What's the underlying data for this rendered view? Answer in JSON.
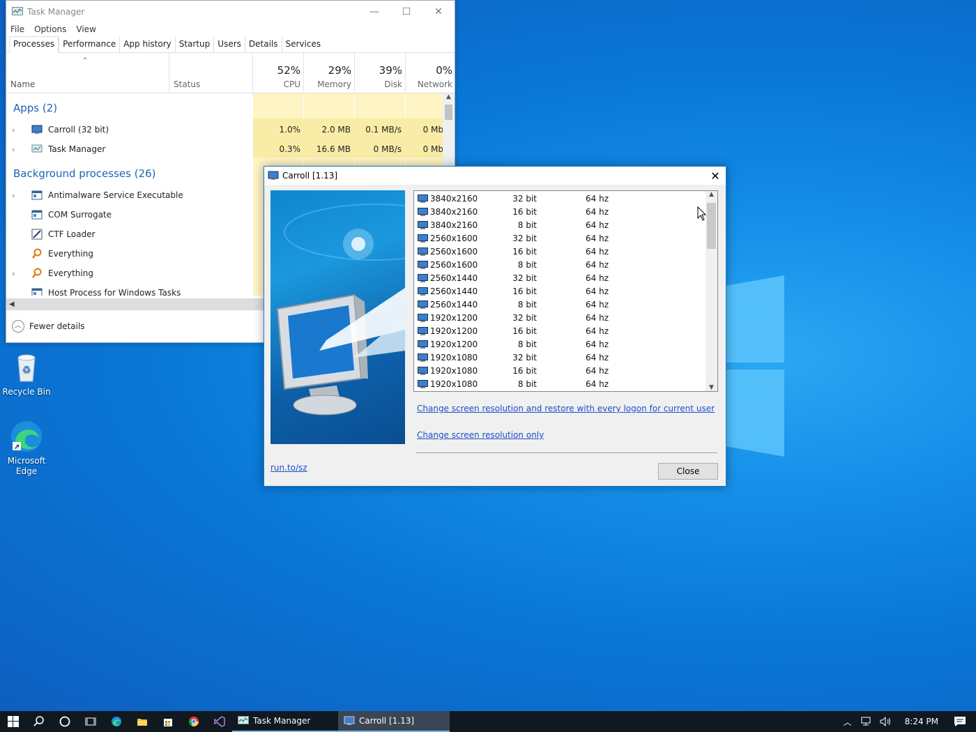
{
  "desktop": {
    "icons": [
      {
        "label": "Recycle Bin"
      },
      {
        "label": "Microsoft Edge"
      }
    ]
  },
  "task_manager": {
    "title": "Task Manager",
    "menu": [
      "File",
      "Options",
      "View"
    ],
    "tabs": [
      "Processes",
      "Performance",
      "App history",
      "Startup",
      "Users",
      "Details",
      "Services"
    ],
    "columns": {
      "name": "Name",
      "status": "Status",
      "cpu": {
        "pct": "52%",
        "label": "CPU"
      },
      "memory": {
        "pct": "29%",
        "label": "Memory"
      },
      "disk": {
        "pct": "39%",
        "label": "Disk"
      },
      "network": {
        "pct": "0%",
        "label": "Network"
      }
    },
    "apps_group": "Apps (2)",
    "apps": [
      {
        "name": "Carroll (32 bit)",
        "cpu": "1.0%",
        "memory": "2.0 MB",
        "disk": "0.1 MB/s",
        "network": "0 Mb"
      },
      {
        "name": "Task Manager",
        "cpu": "0.3%",
        "memory": "16.6 MB",
        "disk": "0 MB/s",
        "network": "0 Mb"
      }
    ],
    "bg_group": "Background processes (26)",
    "bg_processes": [
      {
        "name": "Antimalware Service Executable"
      },
      {
        "name": "COM Surrogate"
      },
      {
        "name": "CTF Loader"
      },
      {
        "name": "Everything"
      },
      {
        "name": "Everything"
      },
      {
        "name": "Host Process for Windows Tasks"
      }
    ],
    "fewer_details": "Fewer details"
  },
  "carroll": {
    "title": "Carroll [1.13]",
    "resolutions": [
      {
        "res": "3840x2160",
        "bit": "32 bit",
        "hz": "64 hz"
      },
      {
        "res": "3840x2160",
        "bit": "16 bit",
        "hz": "64 hz"
      },
      {
        "res": "3840x2160",
        "bit": "8 bit",
        "hz": "64 hz"
      },
      {
        "res": "2560x1600",
        "bit": "32 bit",
        "hz": "64 hz"
      },
      {
        "res": "2560x1600",
        "bit": "16 bit",
        "hz": "64 hz"
      },
      {
        "res": "2560x1600",
        "bit": "8 bit",
        "hz": "64 hz"
      },
      {
        "res": "2560x1440",
        "bit": "32 bit",
        "hz": "64 hz"
      },
      {
        "res": "2560x1440",
        "bit": "16 bit",
        "hz": "64 hz"
      },
      {
        "res": "2560x1440",
        "bit": "8 bit",
        "hz": "64 hz"
      },
      {
        "res": "1920x1200",
        "bit": "32 bit",
        "hz": "64 hz"
      },
      {
        "res": "1920x1200",
        "bit": "16 bit",
        "hz": "64 hz"
      },
      {
        "res": "1920x1200",
        "bit": "8 bit",
        "hz": "64 hz"
      },
      {
        "res": "1920x1080",
        "bit": "32 bit",
        "hz": "64 hz"
      },
      {
        "res": "1920x1080",
        "bit": "16 bit",
        "hz": "64 hz"
      },
      {
        "res": "1920x1080",
        "bit": "8 bit",
        "hz": "64 hz"
      }
    ],
    "link_restore": "Change screen resolution and restore with every logon for current user",
    "link_only": "Change screen resolution only",
    "link_site": "run.to/sz",
    "close_label": "Close"
  },
  "taskbar": {
    "apps": [
      {
        "label": "Task Manager"
      },
      {
        "label": "Carroll [1.13]"
      }
    ],
    "time": "8:24 PM"
  }
}
